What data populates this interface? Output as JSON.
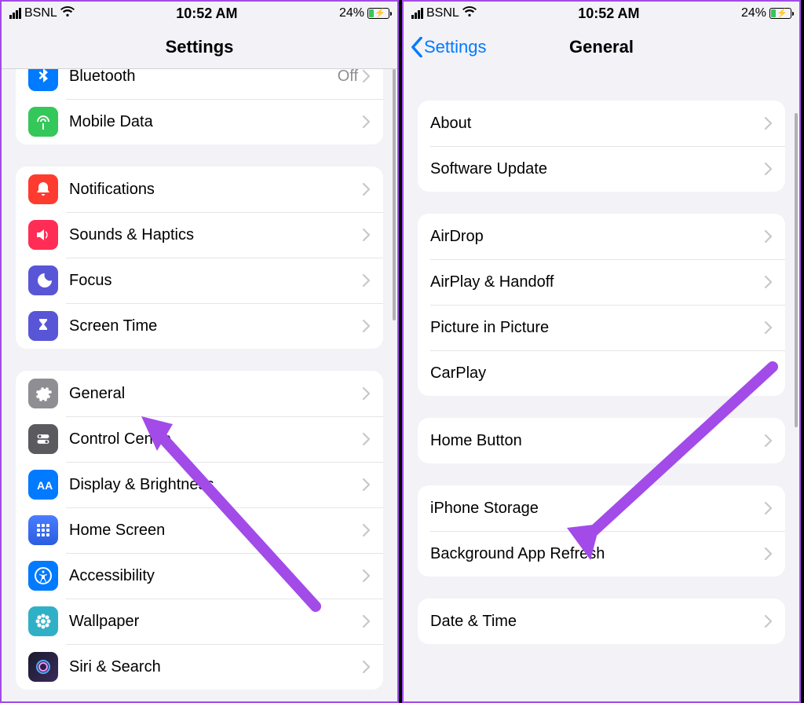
{
  "status": {
    "carrier": "BSNL",
    "time": "10:52 AM",
    "battery": "24%"
  },
  "left": {
    "title": "Settings",
    "group1": [
      {
        "label": "Bluetooth",
        "detail": "Off"
      },
      {
        "label": "Mobile Data"
      }
    ],
    "group2": [
      {
        "label": "Notifications"
      },
      {
        "label": "Sounds & Haptics"
      },
      {
        "label": "Focus"
      },
      {
        "label": "Screen Time"
      }
    ],
    "group3": [
      {
        "label": "General"
      },
      {
        "label": "Control Centre"
      },
      {
        "label": "Display & Brightness"
      },
      {
        "label": "Home Screen"
      },
      {
        "label": "Accessibility"
      },
      {
        "label": "Wallpaper"
      },
      {
        "label": "Siri & Search"
      }
    ]
  },
  "right": {
    "back": "Settings",
    "title": "General",
    "group1": [
      {
        "label": "About"
      },
      {
        "label": "Software Update"
      }
    ],
    "group2": [
      {
        "label": "AirDrop"
      },
      {
        "label": "AirPlay & Handoff"
      },
      {
        "label": "Picture in Picture"
      },
      {
        "label": "CarPlay"
      }
    ],
    "group3": [
      {
        "label": "Home Button"
      }
    ],
    "group4": [
      {
        "label": "iPhone Storage"
      },
      {
        "label": "Background App Refresh"
      }
    ],
    "group5": [
      {
        "label": "Date & Time"
      }
    ]
  }
}
